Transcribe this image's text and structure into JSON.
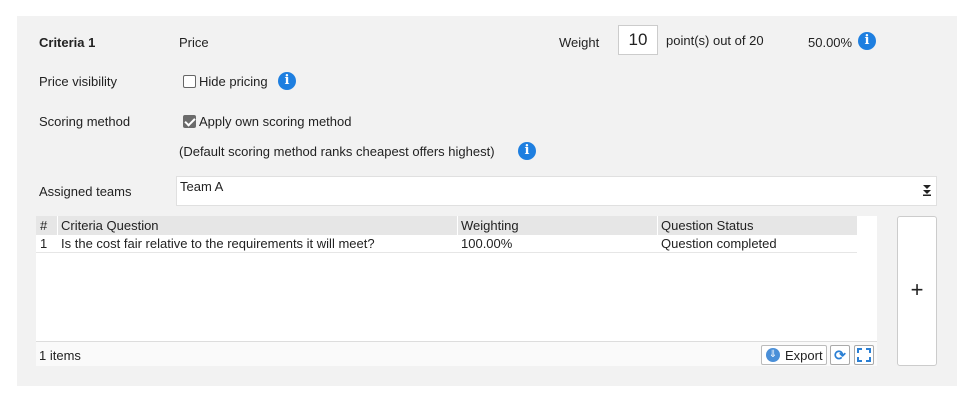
{
  "criteria": {
    "label": "Criteria 1",
    "name": "Price",
    "weight_label": "Weight",
    "weight_value": "10",
    "weight_suffix": "point(s) out of 20",
    "percentage": "50.00%"
  },
  "price_visibility": {
    "label": "Price visibility",
    "checkbox_label": "Hide pricing",
    "checked": false
  },
  "scoring": {
    "label": "Scoring method",
    "checkbox_label": "Apply own scoring method",
    "checked": true,
    "note": "(Default scoring method ranks cheapest offers highest)"
  },
  "teams": {
    "label": "Assigned teams",
    "selected": "Team A"
  },
  "grid": {
    "columns": [
      "#",
      "Criteria Question",
      "Weighting",
      "Question Status"
    ],
    "rows": [
      {
        "num": "1",
        "question": "Is the cost fair relative to the requirements it will meet?",
        "weighting": "100.00%",
        "status": "Question completed"
      }
    ],
    "footer_count": "1 items",
    "export_label": "Export"
  },
  "add_button_label": "+",
  "colors": {
    "panel_bg": "#f2f2f2",
    "accent": "#1e7fe0",
    "header_bg": "#e6e6e6"
  },
  "icons": {
    "info": "info-icon",
    "export": "export-icon",
    "refresh": "refresh-icon",
    "expand": "expand-icon",
    "dropdown": "dropdown-arrow-icon"
  }
}
